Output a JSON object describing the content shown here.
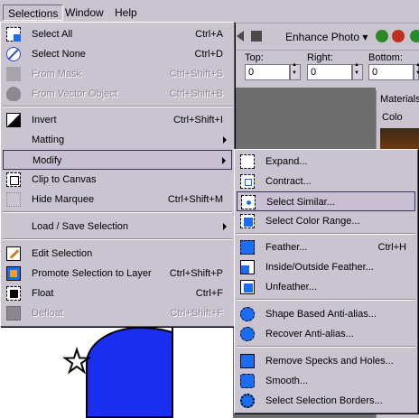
{
  "menubar": {
    "items": [
      {
        "label": "Selections",
        "active": true
      },
      {
        "label": "Window"
      },
      {
        "label": "Help"
      }
    ]
  },
  "toolbar": {
    "enhance_label": "Enhance Photo",
    "enhance_arrow": "▾"
  },
  "params": {
    "top_label": "Top:",
    "top_value": "0",
    "right_label": "Right:",
    "right_value": "0",
    "bottom_label": "Bottom:",
    "bottom_value": "0"
  },
  "palette": {
    "title": "Materials",
    "subtitle": "Colo"
  },
  "selections_menu": {
    "items": [
      {
        "label": "Select All",
        "shortcut": "Ctrl+A",
        "icon": "select-all-icon"
      },
      {
        "label": "Select None",
        "shortcut": "Ctrl+D",
        "icon": "select-none-icon"
      },
      {
        "label": "From Mask",
        "shortcut": "Ctrl+Shift+S",
        "disabled": true,
        "icon": "from-mask-icon"
      },
      {
        "label": "From Vector Object",
        "shortcut": "Ctrl+Shift+B",
        "disabled": true,
        "icon": "from-vector-icon"
      },
      {
        "label": "Invert",
        "shortcut": "Ctrl+Shift+I",
        "icon": "invert-icon"
      },
      {
        "label": "Matting",
        "icon": "",
        "submenu": true
      },
      {
        "label": "Modify",
        "icon": "",
        "submenu": true,
        "highlighted": true
      },
      {
        "label": "Clip to Canvas",
        "icon": "clip-canvas-icon"
      },
      {
        "label": "Hide Marquee",
        "shortcut": "Ctrl+Shift+M",
        "icon": "hide-marquee-icon"
      },
      {
        "label": "Load / Save Selection",
        "icon": "",
        "submenu": true
      },
      {
        "label": "Edit Selection",
        "icon": "edit-selection-icon"
      },
      {
        "label": "Promote Selection to Layer",
        "shortcut": "Ctrl+Shift+P",
        "icon": "promote-icon"
      },
      {
        "label": "Float",
        "shortcut": "Ctrl+F",
        "icon": "float-icon"
      },
      {
        "label": "Defloat",
        "shortcut": "Ctrl+Shift+F",
        "disabled": true,
        "icon": "defloat-icon"
      }
    ]
  },
  "modify_menu": {
    "items": [
      {
        "label": "Expand...",
        "icon": "expand-icon"
      },
      {
        "label": "Contract...",
        "icon": "contract-icon"
      },
      {
        "label": "Select Similar...",
        "icon": "select-similar-icon",
        "highlighted": true
      },
      {
        "label": "Select Color Range...",
        "icon": "color-range-icon"
      },
      {
        "label": "Feather...",
        "shortcut": "Ctrl+H",
        "icon": "feather-icon"
      },
      {
        "label": "Inside/Outside Feather...",
        "icon": "inside-outside-feather-icon"
      },
      {
        "label": "Unfeather...",
        "icon": "unfeather-icon"
      },
      {
        "label": "Shape Based Anti-alias...",
        "icon": "shape-antialias-icon"
      },
      {
        "label": "Recover Anti-alias...",
        "icon": "recover-antialias-icon"
      },
      {
        "label": "Remove Specks and Holes...",
        "icon": "remove-specks-icon"
      },
      {
        "label": "Smooth...",
        "icon": "smooth-icon"
      },
      {
        "label": "Select Selection Borders...",
        "icon": "selection-borders-icon"
      }
    ]
  },
  "colors": {
    "menu_bg": "#c9c4cf",
    "highlight_bg": "#c8bfd2",
    "highlight_border": "#3b2e5a",
    "disabled_text": "#8c8892",
    "selection_blue": "#1a2ef0"
  }
}
